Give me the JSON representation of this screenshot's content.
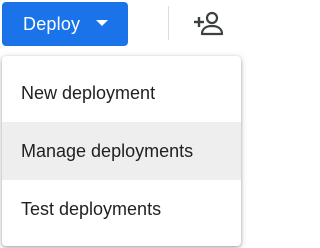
{
  "toolbar": {
    "deploy_label": "Deploy",
    "caret_icon": "caret-down-icon",
    "share_icon": "person-add-icon"
  },
  "menu": {
    "items": [
      {
        "label": "New deployment",
        "highlighted": false
      },
      {
        "label": "Manage deployments",
        "highlighted": true
      },
      {
        "label": "Test deployments",
        "highlighted": false
      }
    ]
  },
  "colors": {
    "primary": "#1a73e8",
    "menu_hover": "#eeeeee",
    "text": "#202124",
    "icon": "#3c4043"
  }
}
